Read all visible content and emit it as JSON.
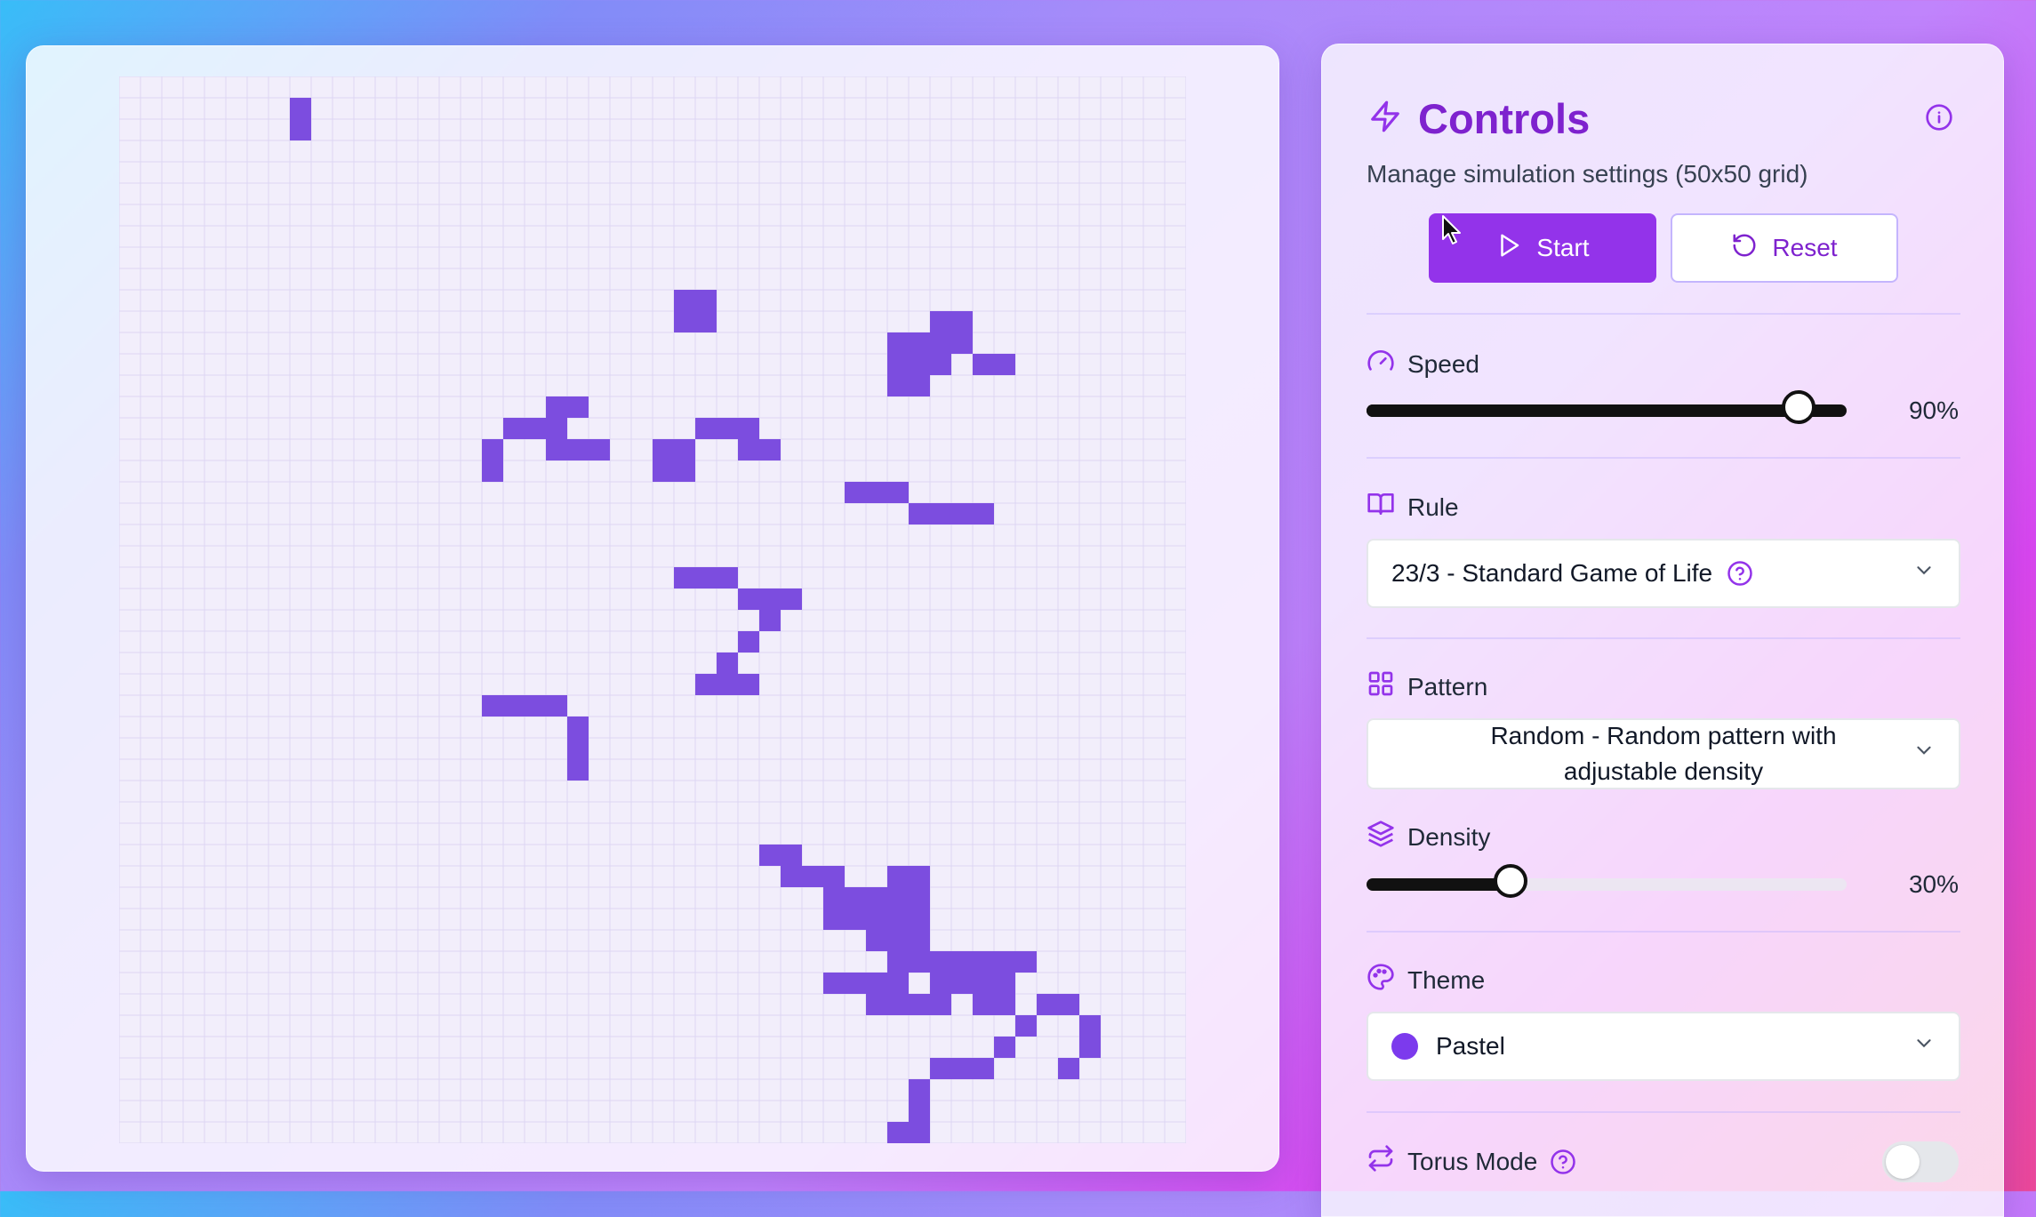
{
  "grid": {
    "size": 50,
    "alive_color": "#7c4ddf",
    "line_color": "#ddd6f3",
    "bg_color": "#f2eefb",
    "live_cells": [
      [
        8,
        1
      ],
      [
        8,
        2
      ],
      [
        26,
        10
      ],
      [
        26,
        11
      ],
      [
        27,
        10
      ],
      [
        27,
        11
      ],
      [
        18,
        16
      ],
      [
        19,
        16
      ],
      [
        20,
        16
      ],
      [
        20,
        17
      ],
      [
        21,
        17
      ],
      [
        22,
        17
      ],
      [
        36,
        12
      ],
      [
        36,
        13
      ],
      [
        36,
        14
      ],
      [
        37,
        12
      ],
      [
        37,
        13
      ],
      [
        37,
        14
      ],
      [
        38,
        11
      ],
      [
        38,
        12
      ],
      [
        38,
        13
      ],
      [
        39,
        11
      ],
      [
        39,
        12
      ],
      [
        40,
        13
      ],
      [
        41,
        13
      ],
      [
        20,
        15
      ],
      [
        21,
        15
      ],
      [
        25,
        17
      ],
      [
        26,
        17
      ],
      [
        25,
        18
      ],
      [
        26,
        18
      ],
      [
        17,
        17
      ],
      [
        17,
        18
      ],
      [
        27,
        16
      ],
      [
        28,
        16
      ],
      [
        29,
        16
      ],
      [
        29,
        17
      ],
      [
        30,
        17
      ],
      [
        34,
        19
      ],
      [
        35,
        19
      ],
      [
        36,
        19
      ],
      [
        37,
        20
      ],
      [
        38,
        20
      ],
      [
        39,
        20
      ],
      [
        40,
        20
      ],
      [
        26,
        23
      ],
      [
        27,
        23
      ],
      [
        28,
        23
      ],
      [
        29,
        24
      ],
      [
        30,
        24
      ],
      [
        31,
        24
      ],
      [
        30,
        25
      ],
      [
        29,
        26
      ],
      [
        28,
        27
      ],
      [
        27,
        28
      ],
      [
        28,
        28
      ],
      [
        29,
        28
      ],
      [
        17,
        29
      ],
      [
        18,
        29
      ],
      [
        19,
        29
      ],
      [
        20,
        29
      ],
      [
        21,
        30
      ],
      [
        21,
        31
      ],
      [
        21,
        32
      ],
      [
        36,
        37
      ],
      [
        37,
        37
      ],
      [
        36,
        38
      ],
      [
        37,
        38
      ],
      [
        35,
        40
      ],
      [
        36,
        40
      ],
      [
        37,
        40
      ],
      [
        38,
        41
      ],
      [
        39,
        41
      ],
      [
        40,
        41
      ],
      [
        41,
        41
      ],
      [
        42,
        41
      ],
      [
        41,
        42
      ],
      [
        40,
        43
      ],
      [
        41,
        43
      ],
      [
        42,
        44
      ],
      [
        41,
        45
      ],
      [
        40,
        46
      ],
      [
        39,
        46
      ],
      [
        38,
        46
      ],
      [
        37,
        47
      ],
      [
        37,
        48
      ],
      [
        36,
        49
      ],
      [
        37,
        49
      ],
      [
        43,
        43
      ],
      [
        44,
        43
      ],
      [
        45,
        44
      ],
      [
        45,
        45
      ],
      [
        44,
        46
      ],
      [
        30,
        36
      ],
      [
        31,
        36
      ],
      [
        31,
        37
      ],
      [
        32,
        37
      ],
      [
        33,
        37
      ],
      [
        33,
        38
      ],
      [
        34,
        38
      ],
      [
        35,
        38
      ],
      [
        36,
        39
      ],
      [
        37,
        39
      ],
      [
        33,
        39
      ],
      [
        34,
        39
      ],
      [
        35,
        39
      ],
      [
        36,
        41
      ],
      [
        37,
        41
      ],
      [
        38,
        42
      ],
      [
        39,
        42
      ],
      [
        40,
        42
      ],
      [
        33,
        42
      ],
      [
        34,
        42
      ],
      [
        35,
        42
      ],
      [
        36,
        42
      ],
      [
        35,
        43
      ],
      [
        36,
        43
      ],
      [
        37,
        43
      ],
      [
        38,
        43
      ]
    ],
    "cell_positions_note": ""
  },
  "panel": {
    "title": "Controls",
    "subtitle": "Manage simulation settings (50x50 grid)",
    "start_label": "Start",
    "reset_label": "Reset",
    "speed": {
      "label": "Speed",
      "value": 0.9,
      "display": "90%"
    },
    "rule": {
      "label": "Rule",
      "selected": "23/3 - Standard Game of Life"
    },
    "pattern": {
      "label": "Pattern",
      "selected": "Random - Random pattern with adjustable density"
    },
    "density": {
      "label": "Density",
      "value": 0.3,
      "display": "30%"
    },
    "theme": {
      "label": "Theme",
      "selected": "Pastel",
      "swatch": "#7c3aed"
    },
    "torus": {
      "label": "Torus Mode",
      "enabled": false
    }
  },
  "colors": {
    "accent": "#9333ea",
    "title": "#7e22ce",
    "icon": "#9333ea"
  }
}
